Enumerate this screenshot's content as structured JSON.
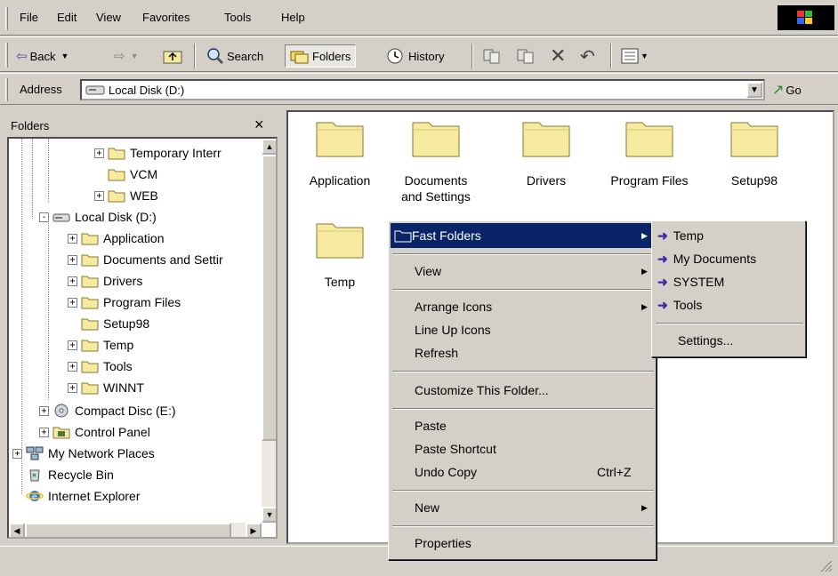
{
  "menubar": {
    "items": [
      "File",
      "Edit",
      "View",
      "Favorites",
      "Tools",
      "Help"
    ]
  },
  "toolbar": {
    "back": "Back",
    "search": "Search",
    "folders": "Folders",
    "history": "History"
  },
  "address": {
    "label": "Address",
    "value": "Local Disk (D:)",
    "go": "Go"
  },
  "folders_pane": {
    "title": "Folders",
    "tree": [
      {
        "label": "Temporary Interr",
        "expander": "+"
      },
      {
        "label": "VCM",
        "expander": ""
      },
      {
        "label": "WEB",
        "expander": "+"
      },
      {
        "label": "Local Disk (D:)",
        "expander": "-"
      },
      {
        "label": "Application",
        "expander": "+"
      },
      {
        "label": "Documents and Settir",
        "expander": "+"
      },
      {
        "label": "Drivers",
        "expander": "+"
      },
      {
        "label": "Program Files",
        "expander": "+"
      },
      {
        "label": "Setup98",
        "expander": ""
      },
      {
        "label": "Temp",
        "expander": "+"
      },
      {
        "label": "Tools",
        "expander": "+"
      },
      {
        "label": "WINNT",
        "expander": "+"
      },
      {
        "label": "Compact Disc (E:)",
        "expander": "+"
      },
      {
        "label": "Control Panel",
        "expander": "+"
      },
      {
        "label": "My Network Places",
        "expander": "+"
      },
      {
        "label": "Recycle Bin",
        "expander": ""
      },
      {
        "label": "Internet Explorer",
        "expander": ""
      }
    ]
  },
  "content": {
    "items": [
      {
        "line1": "Application",
        "line2": ""
      },
      {
        "line1": "Documents",
        "line2": "and Settings"
      },
      {
        "line1": "Drivers",
        "line2": ""
      },
      {
        "line1": "Program Files",
        "line2": ""
      },
      {
        "line1": "Setup98",
        "line2": ""
      },
      {
        "line1": "Temp",
        "line2": ""
      }
    ]
  },
  "context_menu": {
    "fast_folders": "Fast Folders",
    "view": "View",
    "arrange_icons": "Arrange Icons",
    "line_up_icons": "Line Up Icons",
    "refresh": "Refresh",
    "customize": "Customize This Folder...",
    "paste": "Paste",
    "paste_shortcut": "Paste Shortcut",
    "undo_copy": "Undo Copy",
    "undo_shortcut": "Ctrl+Z",
    "new": "New",
    "properties": "Properties"
  },
  "submenu": {
    "items": [
      "Temp",
      "My Documents",
      "SYSTEM",
      "Tools"
    ],
    "settings": "Settings..."
  },
  "colors": {
    "selection": "#0a246a",
    "folder": "#f5eaa0",
    "arrow": "#3a2ca6"
  }
}
